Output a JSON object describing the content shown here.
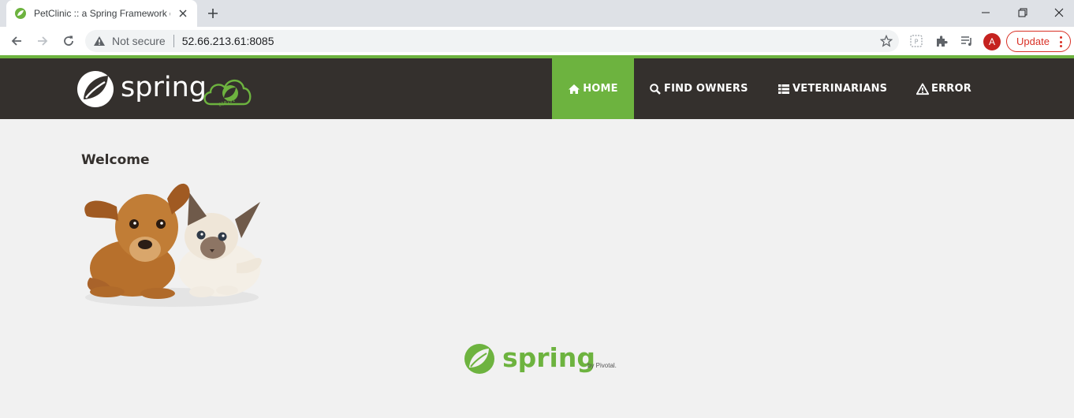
{
  "browser": {
    "tab_title": "PetClinic :: a Spring Framework d",
    "security_label": "Not secure",
    "url": "52.66.213.61:8085",
    "profile_initial": "A",
    "update_label": "Update"
  },
  "navbar": {
    "brand_text": "spring",
    "items": [
      {
        "label": "HOME",
        "icon": "home-icon",
        "active": true
      },
      {
        "label": "FIND OWNERS",
        "icon": "search-icon",
        "active": false
      },
      {
        "label": "VETERINARIANS",
        "icon": "list-icon",
        "active": false
      },
      {
        "label": "ERROR",
        "icon": "warning-icon",
        "active": false
      }
    ]
  },
  "main": {
    "heading": "Welcome"
  },
  "footer": {
    "brand_text": "spring",
    "tagline": "by Pivotal."
  },
  "colors": {
    "spring_green": "#6db33f",
    "navbar_dark": "#34302d",
    "page_bg": "#f1f1f1"
  }
}
